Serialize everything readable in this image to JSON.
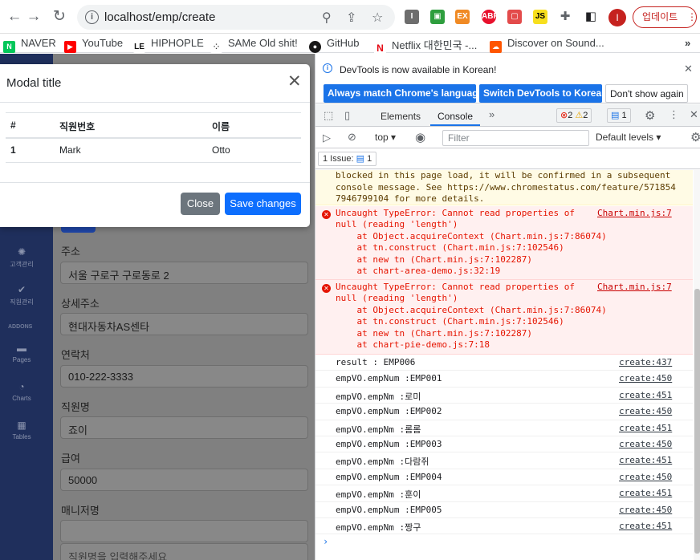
{
  "browser": {
    "url": "localhost/emp/create",
    "update_label": "업데이트",
    "avatar_letter": "I"
  },
  "bookmarks": [
    {
      "label": "NAVER",
      "icon": "naver-icon",
      "color": "#03c75a"
    },
    {
      "label": "YouTube",
      "icon": "youtube-icon",
      "color": "#ff0000"
    },
    {
      "label": "HIPHOPLE",
      "icon": "hiphople-icon",
      "color": "#111111"
    },
    {
      "label": "SAMe Old shit!",
      "icon": "same-old-icon",
      "color": "#333333"
    },
    {
      "label": "GitHub",
      "icon": "github-icon",
      "color": "#181717"
    },
    {
      "label": "Netflix 대한민국 -...",
      "icon": "netflix-icon",
      "color": "#e50914"
    },
    {
      "label": "Discover on Sound...",
      "icon": "soundcloud-icon",
      "color": "#ff5500"
    }
  ],
  "sidebar": {
    "items": [
      {
        "label": "고객관리",
        "icon": "spinner-icon"
      },
      {
        "label": "직원관리",
        "icon": "check-icon"
      },
      {
        "label": "Pages",
        "icon": "folder-icon"
      },
      {
        "label": "Charts",
        "icon": "chart-icon"
      },
      {
        "label": "Tables",
        "icon": "table-icon"
      }
    ],
    "section": "ADDONS"
  },
  "form": {
    "fields": [
      {
        "label": "주소",
        "value": "서울 구로구 구로동로 2"
      },
      {
        "label": "상세주소",
        "value": "현대자동차AS센타"
      },
      {
        "label": "연락처",
        "value": "010-222-3333"
      },
      {
        "label": "직원명",
        "value": "죠이"
      },
      {
        "label": "급여",
        "value": "50000"
      },
      {
        "label": "매니저명",
        "value": ""
      }
    ],
    "extra_placeholder": "직원명을 입력해주세요"
  },
  "modal": {
    "title": "Modal title",
    "columns": [
      "#",
      "직원번호",
      "이름"
    ],
    "rows": [
      [
        "1",
        "Mark",
        "Otto"
      ]
    ],
    "close_label": "Close",
    "save_label": "Save changes"
  },
  "devtools": {
    "info_text": "DevTools is now available in Korean!",
    "btn_match": "Always match Chrome's language",
    "btn_switch": "Switch DevTools to Korean",
    "btn_dont_show": "Don't show again",
    "tabs": [
      "Elements",
      "Console"
    ],
    "err_count": "2",
    "warn_count": "2",
    "msg_count": "1",
    "context": "top",
    "filter_placeholder": "Filter",
    "levels": "Default levels",
    "issues_label": "1 Issue:",
    "issues_count": "1",
    "warning_lines": [
      "blocked in this page load, it will be confirmed in a subsequent",
      "console message. See https://www.chromestatus.com/feature/571854",
      "7946799104 for more details."
    ],
    "errors": [
      {
        "src": "Chart.min.js:7",
        "lines": [
          "Uncaught TypeError: Cannot read properties of",
          "null (reading 'length')",
          "    at Object.acquireContext (Chart.min.js:7:86074)",
          "    at tn.construct (Chart.min.js:7:102546)",
          "    at new tn (Chart.min.js:7:102287)",
          "    at chart-area-demo.js:32:19"
        ]
      },
      {
        "src": "Chart.min.js:7",
        "lines": [
          "Uncaught TypeError: Cannot read properties of",
          "null (reading 'length')",
          "    at Object.acquireContext (Chart.min.js:7:86074)",
          "    at tn.construct (Chart.min.js:7:102546)",
          "    at new tn (Chart.min.js:7:102287)",
          "    at chart-pie-demo.js:7:18"
        ]
      }
    ],
    "logs": [
      {
        "msg": "result : EMP006",
        "src": "create:437"
      },
      {
        "msg": "empVO.empNum :EMP001",
        "src": "create:450"
      },
      {
        "msg": "empVO.empNm :로미",
        "src": "create:451"
      },
      {
        "msg": "empVO.empNum :EMP002",
        "src": "create:450"
      },
      {
        "msg": "empVO.empNm :롬롬",
        "src": "create:451"
      },
      {
        "msg": "empVO.empNum :EMP003",
        "src": "create:450"
      },
      {
        "msg": "empVO.empNm :다람쥐",
        "src": "create:451"
      },
      {
        "msg": "empVO.empNum :EMP004",
        "src": "create:450"
      },
      {
        "msg": "empVO.empNm :훈이",
        "src": "create:451"
      },
      {
        "msg": "empVO.empNum :EMP005",
        "src": "create:450"
      },
      {
        "msg": "empVO.empNm :짱구",
        "src": "create:451"
      }
    ]
  }
}
